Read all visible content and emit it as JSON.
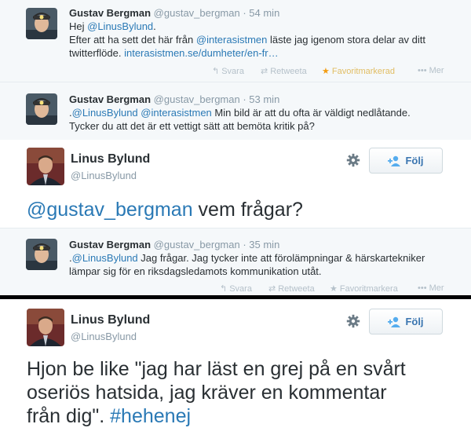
{
  "reply1": {
    "name": "Gustav Bergman",
    "username": "@gustav_bergman",
    "time": "· 54 min",
    "line1": "Hej ",
    "line1_mention": "@LinusBylund",
    "line1_end": ".",
    "line2": "Efter att ha sett det här från ",
    "line2_mention": "@interasistmen",
    "line2_end": " läste jag igenom stora delar av ditt",
    "line3": "twitterflöde. ",
    "line3_link": "interasistmen.se/dumheter/en-fr…",
    "actions": {
      "reply": "Svara",
      "retweet": "Retweeta",
      "favorite": "Favoritmarkerad",
      "more": "Mer"
    }
  },
  "reply2": {
    "name": "Gustav Bergman",
    "username": "@gustav_bergman",
    "time": "· 53 min",
    "line1_pre": ".",
    "line1_mention1": "@LinusBylund",
    "line1_mention2": "@interasistmen",
    "line1_end": " Min bild är att du ofta är väldigt nedlåtande.",
    "line2": "Tycker du att det är ett vettigt sätt att bemöta kritik på?"
  },
  "main1": {
    "name": "Linus Bylund",
    "username": "@LinusBylund",
    "follow": "Följ",
    "text_mention": "@gustav_bergman",
    "text_end": " vem frågar?"
  },
  "reply3": {
    "name": "Gustav Bergman",
    "username": "@gustav_bergman",
    "time": "· 35 min",
    "line1_pre": ".",
    "line1_mention": "@LinusBylund",
    "line1_end": " Jag frågar. Jag tycker inte att förolämpningar & härskartekniker",
    "line2": "lämpar sig för en riksdagsledamots kommunikation utåt.",
    "actions": {
      "reply": "Svara",
      "retweet": "Retweeta",
      "favorite": "Favoritmarkera",
      "more": "Mer"
    }
  },
  "main2": {
    "name": "Linus Bylund",
    "username": "@LinusBylund",
    "follow": "Följ",
    "line1": "Hjon be like \"jag har läst en grej på en svårt",
    "line2": "oseriös hatsida, jag kräver en kommentar",
    "line3": "från dig\". ",
    "hashtag": "#hehenej"
  }
}
